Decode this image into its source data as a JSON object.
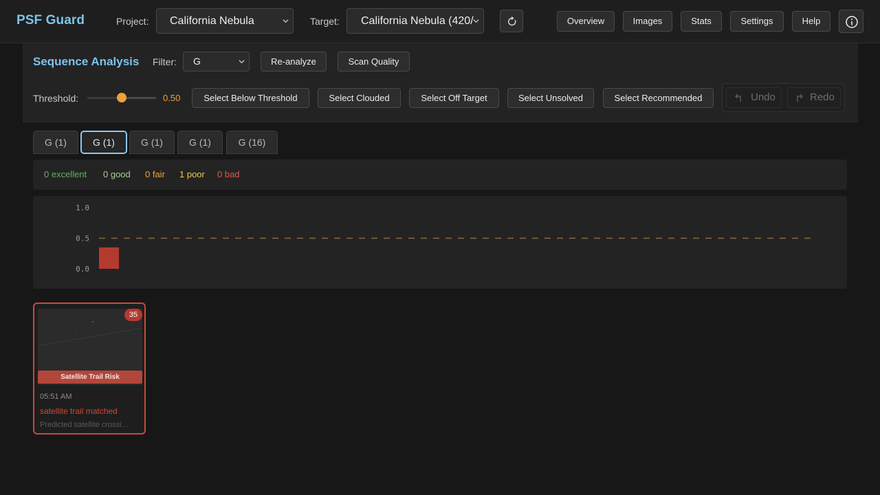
{
  "header": {
    "brand": "PSF Guard",
    "project_label": "Project:",
    "project_value": "California Nebula",
    "target_label": "Target:",
    "target_value": "California Nebula (420/",
    "nav": [
      "Overview",
      "Images",
      "Stats",
      "Settings",
      "Help"
    ]
  },
  "sequence": {
    "title": "Sequence Analysis",
    "filter_label": "Filter:",
    "filter_value": "G",
    "reanalyze_label": "Re-analyze",
    "scan_label": "Scan Quality",
    "threshold_label": "Threshold:",
    "threshold_value": "0.50",
    "threshold_fraction": 0.5,
    "actions": [
      "Select Below Threshold",
      "Select Clouded",
      "Select Off Target",
      "Select Unsolved",
      "Select Recommended"
    ],
    "undo_label": "Undo",
    "redo_label": "Redo"
  },
  "tabs": [
    "G (1)",
    "G (1)",
    "G (1)",
    "G (1)",
    "G (16)"
  ],
  "active_tab": 1,
  "summary": {
    "excellent": "0 excellent",
    "good": "0 good",
    "fair": "0 fair",
    "poor": "1 poor",
    "bad": "0 bad"
  },
  "colors": {
    "accent": "#7cc4ec",
    "threshold": "#f0a23a",
    "excellent": "#5fb35b",
    "good": "#a8d08a",
    "fair": "#f0a23a",
    "poor": "#f2c94c",
    "bad": "#e2584a"
  },
  "chart_data": {
    "type": "bar",
    "y_ticks": [
      "1.0",
      "0.5",
      "0.0"
    ],
    "ylim": [
      0,
      1
    ],
    "threshold": 0.5,
    "values": [
      0.35
    ]
  },
  "card": {
    "score": "35",
    "risk": "Satellite Trail Risk",
    "time": "05:51 AM",
    "match": "satellite trail matched",
    "description": "Predicted satellite crossi..."
  }
}
